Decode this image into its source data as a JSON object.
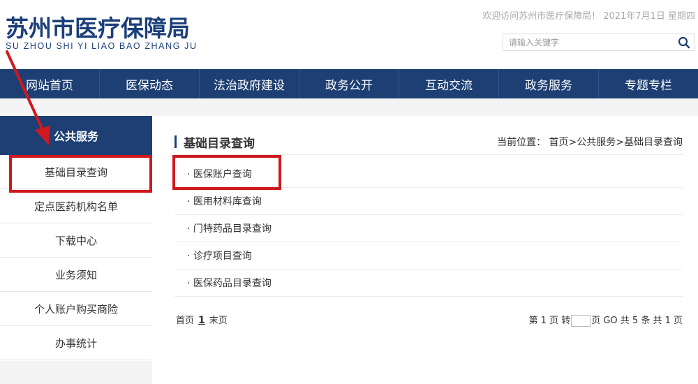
{
  "header": {
    "logo_cn": "苏州市医疗保障局",
    "logo_pinyin": "SU ZHOU SHI YI LIAO BAO ZHANG JU",
    "welcome": "欢迎访问苏州市医疗保障局！ 2021年7月1日 星期四",
    "search_placeholder": "请输入关键字"
  },
  "nav": {
    "items": [
      "网站首页",
      "医保动态",
      "法治政府建设",
      "政务公开",
      "互动交流",
      "政务服务",
      "专题专栏"
    ]
  },
  "sidebar": {
    "heading": "公共服务",
    "items": [
      "基础目录查询",
      "定点医药机构名单",
      "下载中心",
      "业务须知",
      "个人账户购买商险",
      "办事统计"
    ]
  },
  "main": {
    "title": "基础目录查询",
    "breadcrumb": "当前位置： 首页>公共服务>基础目录查询",
    "list": [
      "· 医保账户查询",
      "· 医用材料库查询",
      "· 门特药品目录查询",
      "· 诊疗项目查询",
      "· 医保药品目录查询"
    ]
  },
  "pager": {
    "first": "首页",
    "current": "1",
    "last": "末页",
    "info_prefix": "第 1 页 转",
    "info_suffix": "页 GO 共 5 条 共 1 页"
  },
  "annotation_color": "#d0191e",
  "brand_color": "#1d3f73"
}
